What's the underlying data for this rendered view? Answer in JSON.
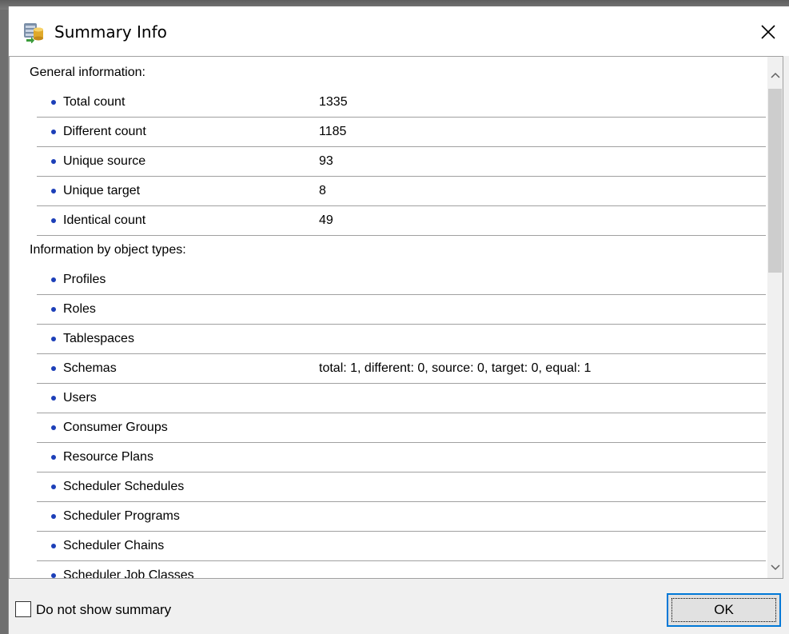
{
  "window": {
    "title": "Summary Info",
    "icons": {
      "app": "database-compare-icon",
      "close": "close-icon"
    }
  },
  "sections": [
    {
      "header": "General information:",
      "items": [
        {
          "label": "Total count",
          "value": "1335"
        },
        {
          "label": "Different count",
          "value": "1185"
        },
        {
          "label": "Unique source",
          "value": "93"
        },
        {
          "label": "Unique target",
          "value": "8"
        },
        {
          "label": "Identical count",
          "value": "49"
        }
      ]
    },
    {
      "header": "Information by object types:",
      "items": [
        {
          "label": "Profiles",
          "value": ""
        },
        {
          "label": "Roles",
          "value": ""
        },
        {
          "label": "Tablespaces",
          "value": ""
        },
        {
          "label": "Schemas",
          "value": "total: 1, different: 0, source: 0, target: 0, equal: 1"
        },
        {
          "label": "Users",
          "value": ""
        },
        {
          "label": "Consumer Groups",
          "value": ""
        },
        {
          "label": "Resource Plans",
          "value": ""
        },
        {
          "label": "Scheduler Schedules",
          "value": ""
        },
        {
          "label": "Scheduler Programs",
          "value": ""
        },
        {
          "label": "Scheduler Chains",
          "value": ""
        },
        {
          "label": "Scheduler Job Classes",
          "value": ""
        }
      ]
    }
  ],
  "footer": {
    "checkbox_label": "Do not show summary",
    "checkbox_checked": false,
    "ok_label": "OK"
  },
  "colors": {
    "bullet": "#1c3fb8",
    "focus_border": "#0078d7",
    "separator": "#a0a0a0"
  }
}
